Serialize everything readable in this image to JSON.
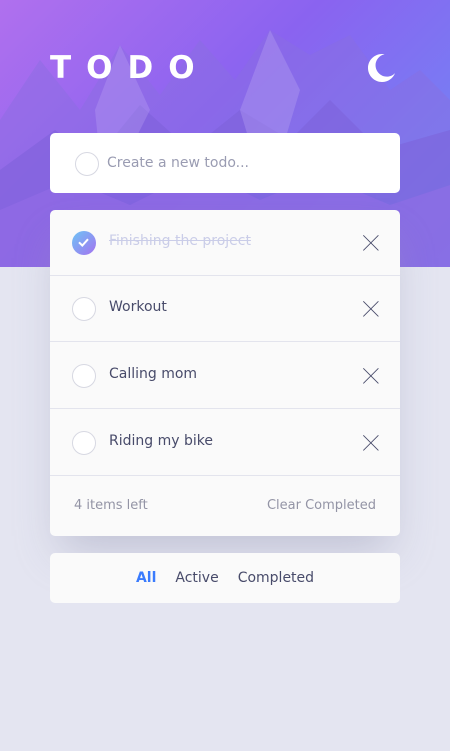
{
  "header": {
    "title": "TODO",
    "theme_icon": "moon-icon"
  },
  "new_todo": {
    "placeholder": "Create a new todo..."
  },
  "todos": [
    {
      "text": "Finishing the project",
      "completed": true
    },
    {
      "text": "Workout",
      "completed": false
    },
    {
      "text": "Calling mom",
      "completed": false
    },
    {
      "text": "Riding my bike",
      "completed": false
    }
  ],
  "footer": {
    "items_left": "4 items left",
    "clear_label": "Clear Completed"
  },
  "filters": {
    "all": "All",
    "active": "Active",
    "completed": "Completed",
    "selected": "All"
  },
  "colors": {
    "accent": "#3a7bfd",
    "background": "#e4e5f1",
    "card": "#fafafa",
    "text": "#484b6a",
    "muted": "#9394a5",
    "completed_text": "#cacde8",
    "check_gradient_start": "#6ec4f5",
    "check_gradient_end": "#a472f0"
  }
}
